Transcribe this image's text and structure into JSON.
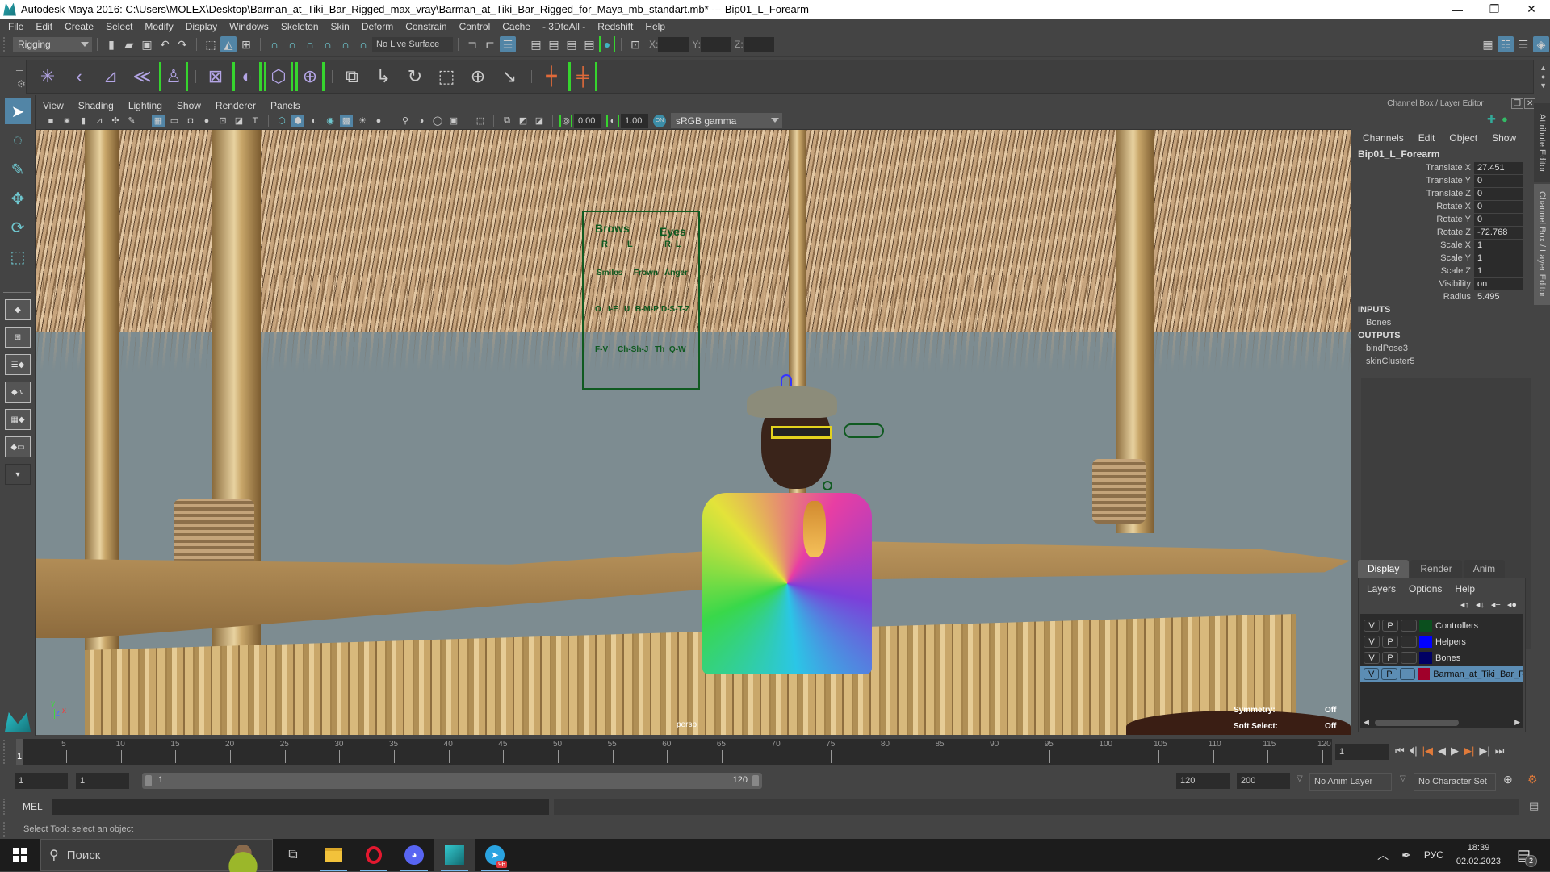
{
  "window": {
    "title": "Autodesk Maya 2016: C:\\Users\\MOLEX\\Desktop\\Barman_at_Tiki_Bar_Rigged_max_vray\\Barman_at_Tiki_Bar_Rigged_for_Maya_mb_standart.mb*  ---  Bip01_L_Forearm",
    "minimize": "—",
    "maximize": "❐",
    "close": "✕"
  },
  "menubar": [
    "File",
    "Edit",
    "Create",
    "Select",
    "Modify",
    "Display",
    "Windows",
    "Skeleton",
    "Skin",
    "Deform",
    "Constrain",
    "Control",
    "Cache",
    "- 3DtoAll -",
    "Redshift",
    "Help"
  ],
  "statusline": {
    "menuset": "Rigging",
    "live_surface": "No Live Surface",
    "x_label": "X:",
    "y_label": "Y:",
    "z_label": "Z:",
    "x_value": "",
    "y_value": "",
    "z_value": ""
  },
  "viewport": {
    "menu": [
      "View",
      "Shading",
      "Lighting",
      "Show",
      "Renderer",
      "Panels"
    ],
    "exposure": "0.00",
    "gamma": "1.00",
    "color_space": "sRGB gamma",
    "camera": "persp",
    "hud": {
      "symmetry_label": "Symmetry:",
      "symmetry_value": "Off",
      "soft_select_label": "Soft Select:",
      "soft_select_value": "Off"
    },
    "face_controls": {
      "brows": "Brows",
      "eyes": "Eyes",
      "r": "R",
      "l": "L",
      "smiles": "Smiles",
      "frown": "Frown",
      "anger": "Anger",
      "row2": [
        "O",
        "I-E",
        "U",
        "B-M-P",
        "D-S-T-Z"
      ],
      "row3": [
        "F-V",
        "Ch-Sh-J",
        "Th",
        "Q-W"
      ]
    },
    "axis": {
      "x": "x",
      "y": "y",
      "z": "z"
    }
  },
  "channel_box": {
    "header": "Channel Box / Layer Editor",
    "menu": [
      "Channels",
      "Edit",
      "Object",
      "Show"
    ],
    "object": "Bip01_L_Forearm",
    "channels": [
      {
        "label": "Translate X",
        "value": "27.451"
      },
      {
        "label": "Translate Y",
        "value": "0"
      },
      {
        "label": "Translate Z",
        "value": "0"
      },
      {
        "label": "Rotate X",
        "value": "0"
      },
      {
        "label": "Rotate Y",
        "value": "0"
      },
      {
        "label": "Rotate Z",
        "value": "-72.768"
      },
      {
        "label": "Scale X",
        "value": "1"
      },
      {
        "label": "Scale Y",
        "value": "1"
      },
      {
        "label": "Scale Z",
        "value": "1"
      },
      {
        "label": "Visibility",
        "value": "on"
      },
      {
        "label": "Radius",
        "value": "5.495"
      }
    ],
    "inputs_label": "INPUTS",
    "inputs": [
      "Bones"
    ],
    "outputs_label": "OUTPUTS",
    "outputs": [
      "bindPose3",
      "skinCluster5"
    ],
    "side_tabs": [
      "Attribute Editor",
      "Channel Box / Layer Editor"
    ]
  },
  "layer_editor": {
    "tabs": [
      "Display",
      "Render",
      "Anim"
    ],
    "menu": [
      "Layers",
      "Options",
      "Help"
    ],
    "layers": [
      {
        "v": "V",
        "p": "P",
        "color": "#0b4f1e",
        "name": "Controllers",
        "selected": false
      },
      {
        "v": "V",
        "p": "P",
        "color": "#0000ff",
        "name": "Helpers",
        "selected": false
      },
      {
        "v": "V",
        "p": "P",
        "color": "#000064",
        "name": "Bones",
        "selected": false
      },
      {
        "v": "V",
        "p": "P",
        "color": "#a0002a",
        "name": "Barman_at_Tiki_Bar_Ri",
        "selected": true
      }
    ]
  },
  "timeline": {
    "ticks": [
      "5",
      "10",
      "15",
      "20",
      "25",
      "30",
      "35",
      "40",
      "45",
      "50",
      "55",
      "60",
      "65",
      "70",
      "75",
      "80",
      "85",
      "90",
      "95",
      "100",
      "105",
      "110",
      "115",
      "120"
    ],
    "current_frame_marker": "1",
    "current_frame": "1"
  },
  "range": {
    "start": "1",
    "playback_start": "1",
    "slider_start": "1",
    "slider_end": "120",
    "playback_end": "120",
    "end": "200",
    "anim_layer": "No Anim Layer",
    "character_set": "No Character Set"
  },
  "command_line": {
    "label": "MEL",
    "value": ""
  },
  "help_line": "Select Tool: select an object",
  "taskbar": {
    "search_placeholder": "Поиск",
    "language": "РУС",
    "time": "18:39",
    "date": "02.02.2023",
    "notifications": "2",
    "telegram_badge": "96"
  }
}
